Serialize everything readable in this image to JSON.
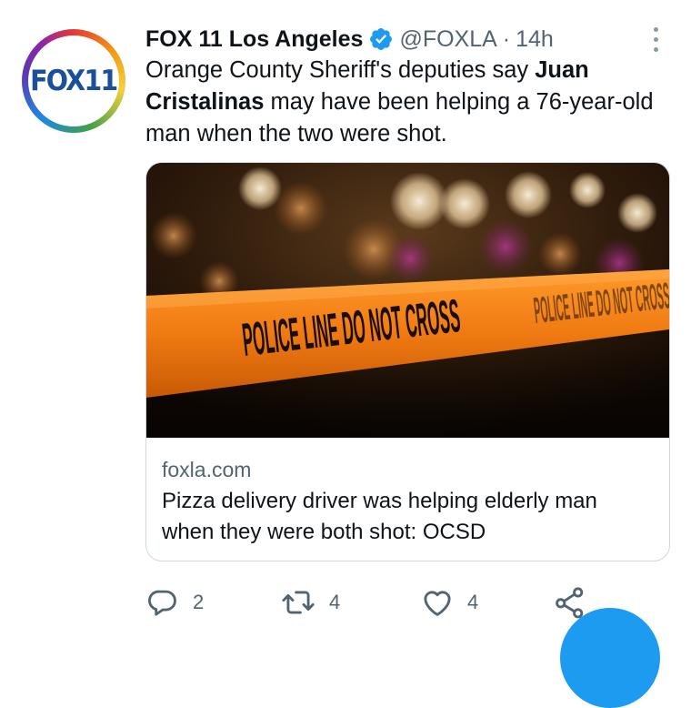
{
  "tweet": {
    "author_name": "FOX 11 Los Angeles",
    "handle": "@FOXLA",
    "separator": "·",
    "time": "14h",
    "avatar_text": "FOX11",
    "text_before": "Orange County Sheriff's deputies say ",
    "text_bold": "Juan Cristalinas",
    "text_after": " may have been helping a 76-year-old man when the two were shot.",
    "card": {
      "image_caption": "POLICE LINE DO NOT CROSS",
      "domain": "foxla.com",
      "title": "Pizza delivery driver was helping elderly man when they were both shot: OCSD"
    },
    "actions": {
      "replies": "2",
      "retweets": "4",
      "likes": "4"
    }
  },
  "colors": {
    "verified": "#1d9bf0",
    "tape": "#f07a12",
    "secondary_text": "#536471",
    "fab": "#1d9bf0"
  },
  "icons": [
    "verified-badge-icon",
    "more-options-icon",
    "reply-icon",
    "retweet-icon",
    "like-icon",
    "share-icon"
  ]
}
